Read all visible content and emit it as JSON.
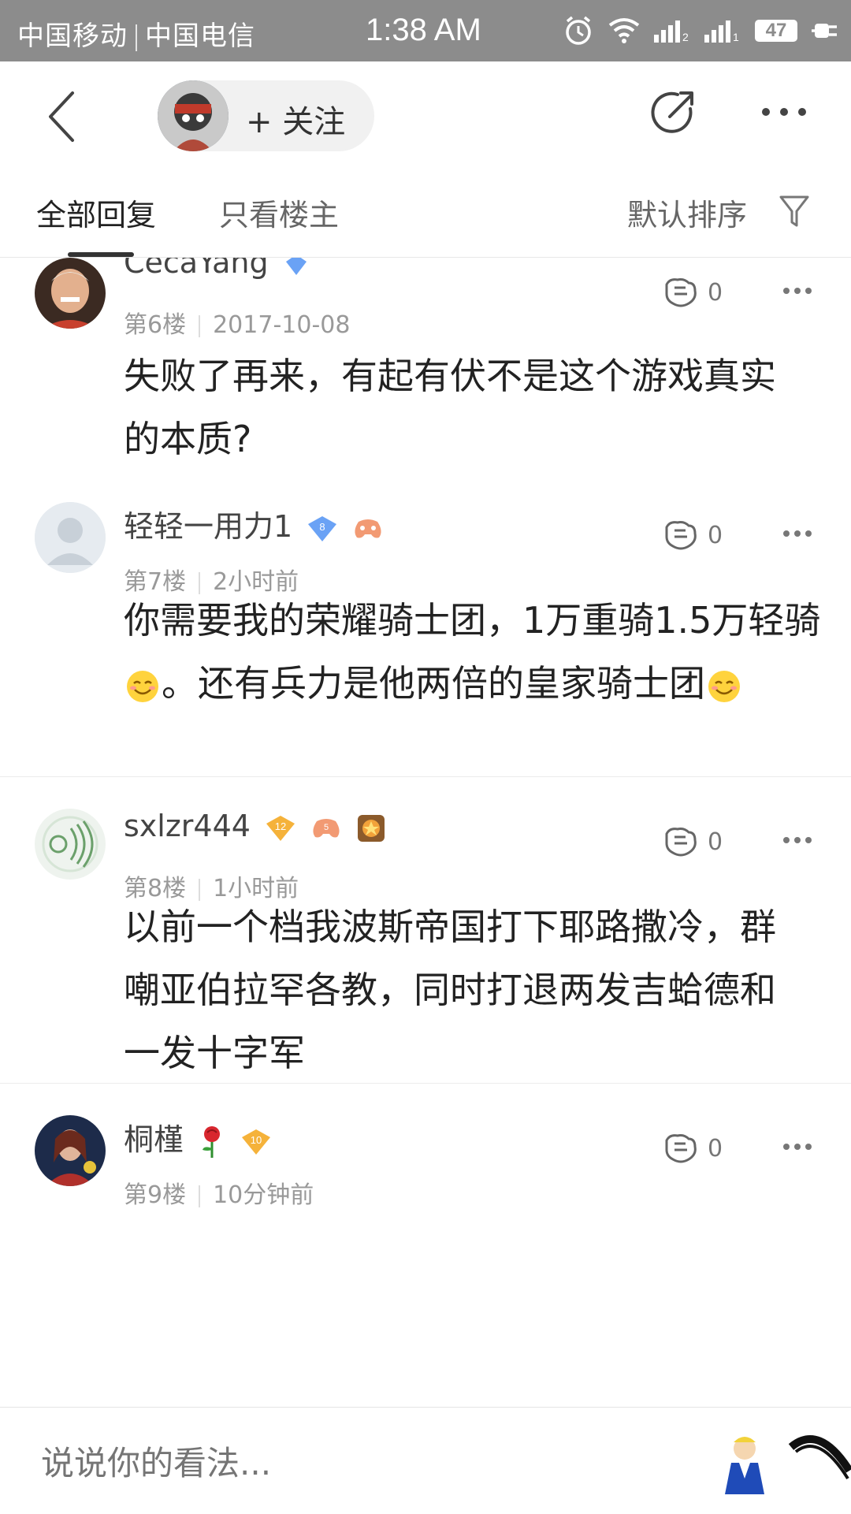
{
  "status_bar": {
    "carrier_1": "中国移动",
    "carrier_2": "中国电信",
    "time": "1:38 AM",
    "battery": "47"
  },
  "header": {
    "follow_label": "+ 关注"
  },
  "tabs": {
    "all_replies": "全部回复",
    "op_only": "只看楼主",
    "sort_label": "默认排序"
  },
  "posts": [
    {
      "username": "CecaYang",
      "floor": "第6楼",
      "time": "2017-10-08",
      "likes": "0",
      "content": "失败了再来，有起有伏不是这个游戏真实的本质?"
    },
    {
      "username": "轻轻一用力1",
      "badge_level": "8",
      "floor": "第7楼",
      "time": "2小时前",
      "likes": "0",
      "content_part1": "你需要我的荣耀骑士团，1万重骑1.5万轻骑",
      "content_part2": "。还有兵力是他两倍的皇家骑士团"
    },
    {
      "username": "sxlzr444",
      "badge_level": "12",
      "game_level": "5",
      "floor": "第8楼",
      "time": "1小时前",
      "likes": "0",
      "content": "以前一个档我波斯帝国打下耶路撒冷，群嘲亚伯拉罕各教，同时打退两发吉蛤德和一发十字军"
    },
    {
      "username": "桐槿",
      "badge_level": "10",
      "floor": "第9楼",
      "time": "10分钟前",
      "likes": "0"
    }
  ],
  "comment_input": {
    "placeholder": "说说你的看法..."
  }
}
